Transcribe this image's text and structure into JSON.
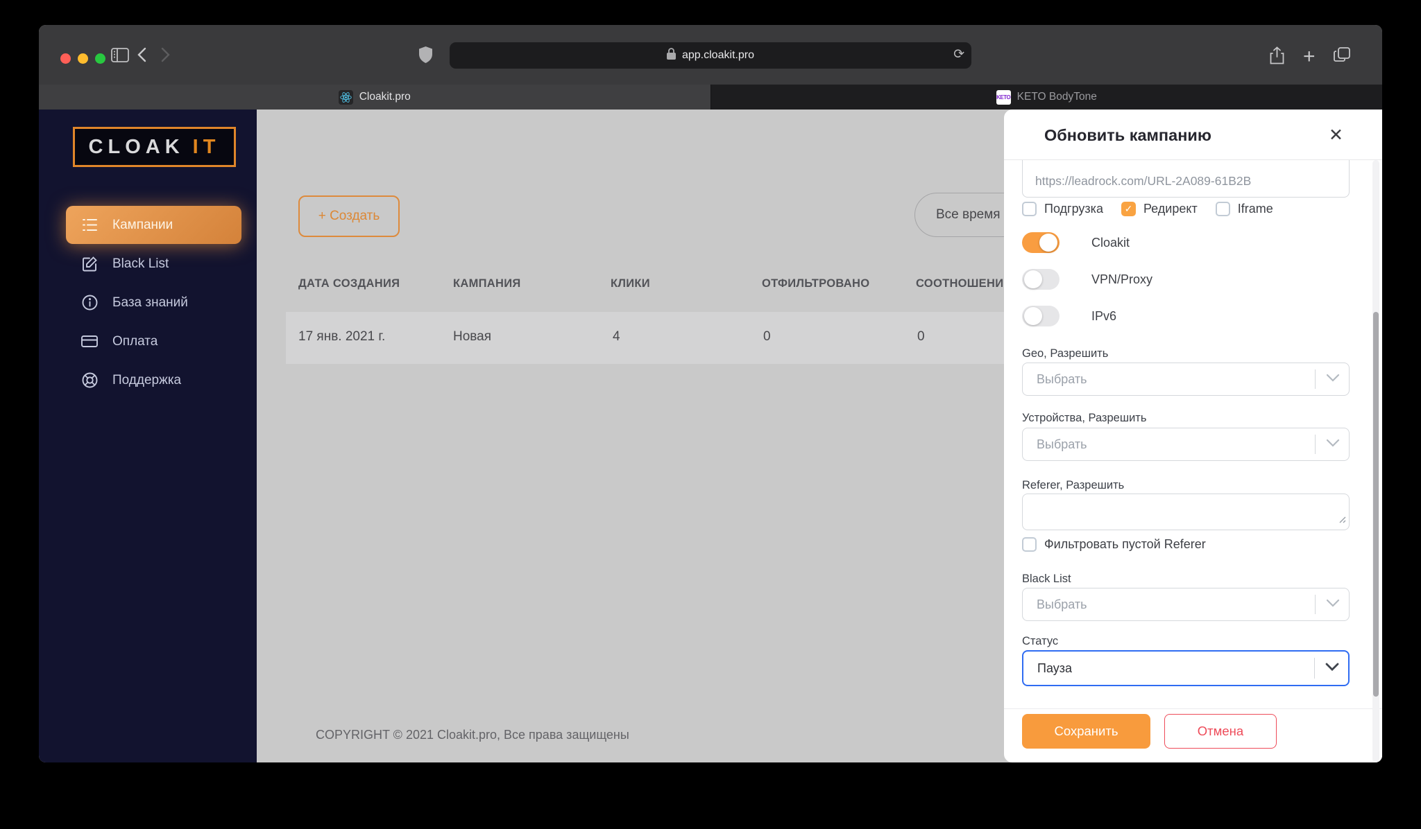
{
  "browser": {
    "url": "app.cloakit.pro",
    "tabs": [
      {
        "label": "Cloakit.pro"
      },
      {
        "label": "KETO BodyTone",
        "favicon_text": "KETO"
      }
    ]
  },
  "sidebar": {
    "logo": {
      "part1": "CLOAK",
      "part2": "IT"
    },
    "items": [
      {
        "label": "Кампании",
        "icon": "list-icon",
        "active": true
      },
      {
        "label": "Black List",
        "icon": "edit-icon",
        "active": false
      },
      {
        "label": "База знаний",
        "icon": "info-icon",
        "active": false
      },
      {
        "label": "Оплата",
        "icon": "card-icon",
        "active": false
      },
      {
        "label": "Поддержка",
        "icon": "support-icon",
        "active": false
      }
    ]
  },
  "main": {
    "create_button": "+ Создать",
    "time_filter": "Все время",
    "table": {
      "headers": [
        "ДАТА СОЗДАНИЯ",
        "КАМПАНИЯ",
        "КЛИКИ",
        "ОТФИЛЬТРОВАНО",
        "СООТНОШЕНИ"
      ],
      "row": [
        "17 янв. 2021 г.",
        "Новая",
        "4",
        "0",
        "0"
      ]
    },
    "footer": "COPYRIGHT © 2021 Cloakit.pro, Все права защищены"
  },
  "modal": {
    "title": "Обновить кампанию",
    "close_icon": "✕",
    "url_value": "https://leadrock.com/URL-2A089-61B2B",
    "checkboxes": [
      {
        "label": "Подгрузка",
        "checked": false
      },
      {
        "label": "Редирект",
        "checked": true
      },
      {
        "label": "Iframe",
        "checked": false
      }
    ],
    "check_glyph": "✓",
    "toggles": [
      {
        "label": "Cloakit",
        "on": true
      },
      {
        "label": "VPN/Proxy",
        "on": false
      },
      {
        "label": "IPv6",
        "on": false
      }
    ],
    "geo": {
      "label": "Geo, Разрешить",
      "placeholder": "Выбрать"
    },
    "devices": {
      "label": "Устройства, Разрешить",
      "placeholder": "Выбрать"
    },
    "referer": {
      "label": "Referer, Разрешить",
      "value": "",
      "filter_label": "Фильтровать пустой Referer"
    },
    "blacklist": {
      "label": "Black List",
      "placeholder": "Выбрать"
    },
    "status": {
      "label": "Статус",
      "value": "Пауза"
    },
    "save_button": "Сохранить",
    "cancel_button": "Отмена"
  },
  "colors": {
    "accent_orange": "#f89b3d",
    "cancel_red": "#ee4b59",
    "focus_blue": "#2f6cf2",
    "sidebar_navy": "#12132f",
    "logo_border": "#e0862a",
    "toggle_off": "#e6e6e8",
    "page_dimmed": "#c9c9c9"
  }
}
